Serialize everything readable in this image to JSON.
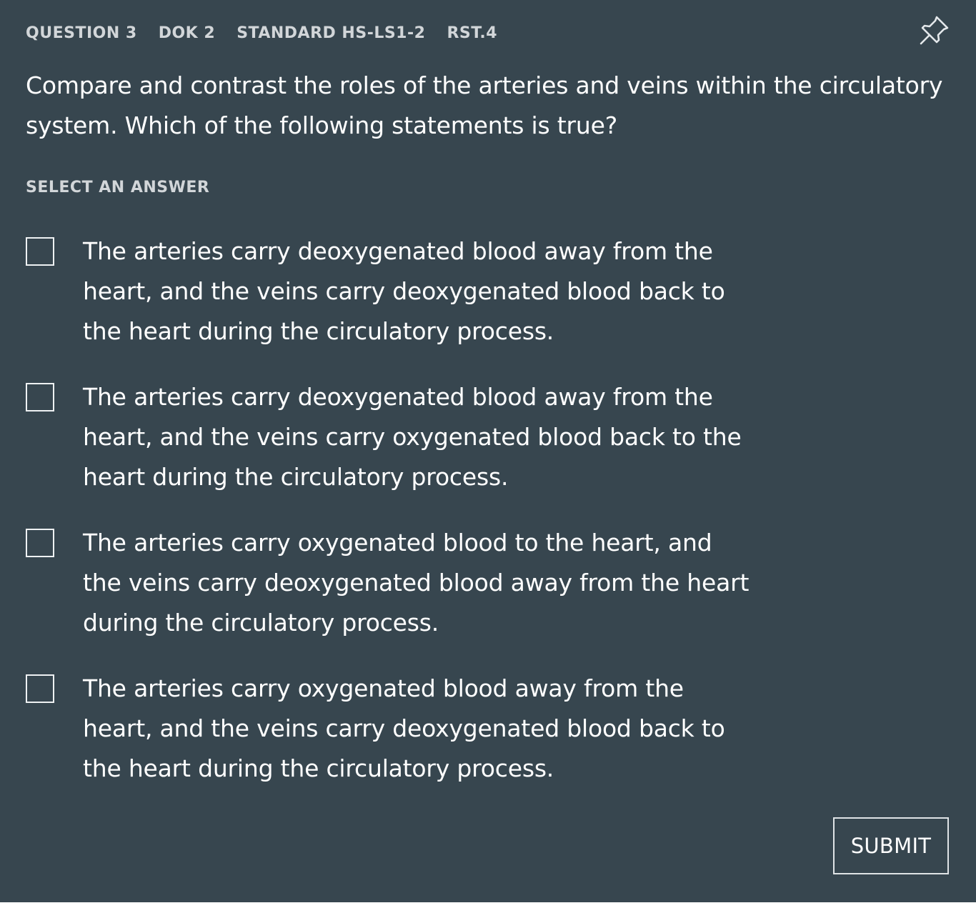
{
  "colors": {
    "background": "#37464f",
    "text": "#ffffff",
    "muted_text": "#d2d6d9"
  },
  "header": {
    "question": "QUESTION 3",
    "dok": "DOK 2",
    "standard": "STANDARD HS-LS1-2",
    "rst": "RST.4",
    "pin_icon": "pin-icon"
  },
  "question_text": "Compare and contrast the roles of the arteries and veins within the circulatory system. Which of the following statements is true?",
  "select_label": "SELECT AN ANSWER",
  "options": [
    {
      "text": "The arteries carry deoxygenated blood away from the heart, and the veins carry deoxygenated blood back to the heart during the circulatory process.",
      "checked": false
    },
    {
      "text": "The arteries carry deoxygenated blood away from the heart, and the veins carry oxygenated blood back to the heart during the circulatory process.",
      "checked": false
    },
    {
      "text": "The arteries carry oxygenated blood to the heart, and the veins carry deoxygenated blood away from the heart during the circulatory process.",
      "checked": false
    },
    {
      "text": "The arteries carry oxygenated blood away from the heart, and the veins carry deoxygenated blood back to the heart during the circulatory process.",
      "checked": false
    }
  ],
  "submit_label": "SUBMIT"
}
